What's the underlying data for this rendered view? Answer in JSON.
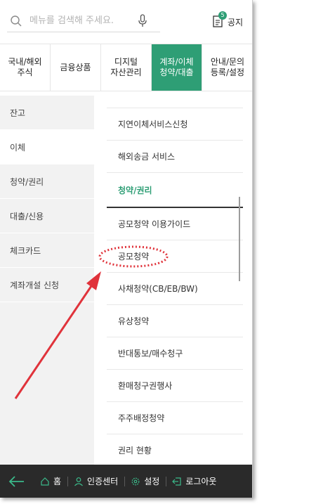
{
  "search": {
    "placeholder": "메뉴를 검색해 주세요."
  },
  "notice": {
    "badge": "5",
    "label": "공지"
  },
  "tabs": [
    {
      "label": "국내/해외\n주식"
    },
    {
      "label": "금융상품"
    },
    {
      "label": "디지털\n자산관리"
    },
    {
      "label": "계좌/이체\n청약/대출"
    },
    {
      "label": "안내/문의\n등록/설정"
    }
  ],
  "left_menu": [
    {
      "label": "잔고"
    },
    {
      "label": "이체"
    },
    {
      "label": "청약/권리"
    },
    {
      "label": "대출/신용"
    },
    {
      "label": "체크카드"
    },
    {
      "label": "계좌개설 신청"
    }
  ],
  "right_menu": [
    {
      "label": "지연이체서비스신청"
    },
    {
      "label": "해외송금 서비스"
    },
    {
      "label": "청약/권리"
    },
    {
      "label": "공모청약 이용가이드"
    },
    {
      "label": "공모청약"
    },
    {
      "label": "사채청약(CB/EB/BW)"
    },
    {
      "label": "유상청약"
    },
    {
      "label": "반대통보/매수청구"
    },
    {
      "label": "환매청구권행사"
    },
    {
      "label": "주주배정청약"
    },
    {
      "label": "권리 현황"
    }
  ],
  "bottom_bar": {
    "home": "홈",
    "auth_center": "인증센터",
    "settings": "설정",
    "logout": "로그아웃"
  },
  "colors": {
    "accent": "#2e9e75",
    "bottom_bar": "#2a2a2a",
    "annotation": "#e0333b"
  }
}
